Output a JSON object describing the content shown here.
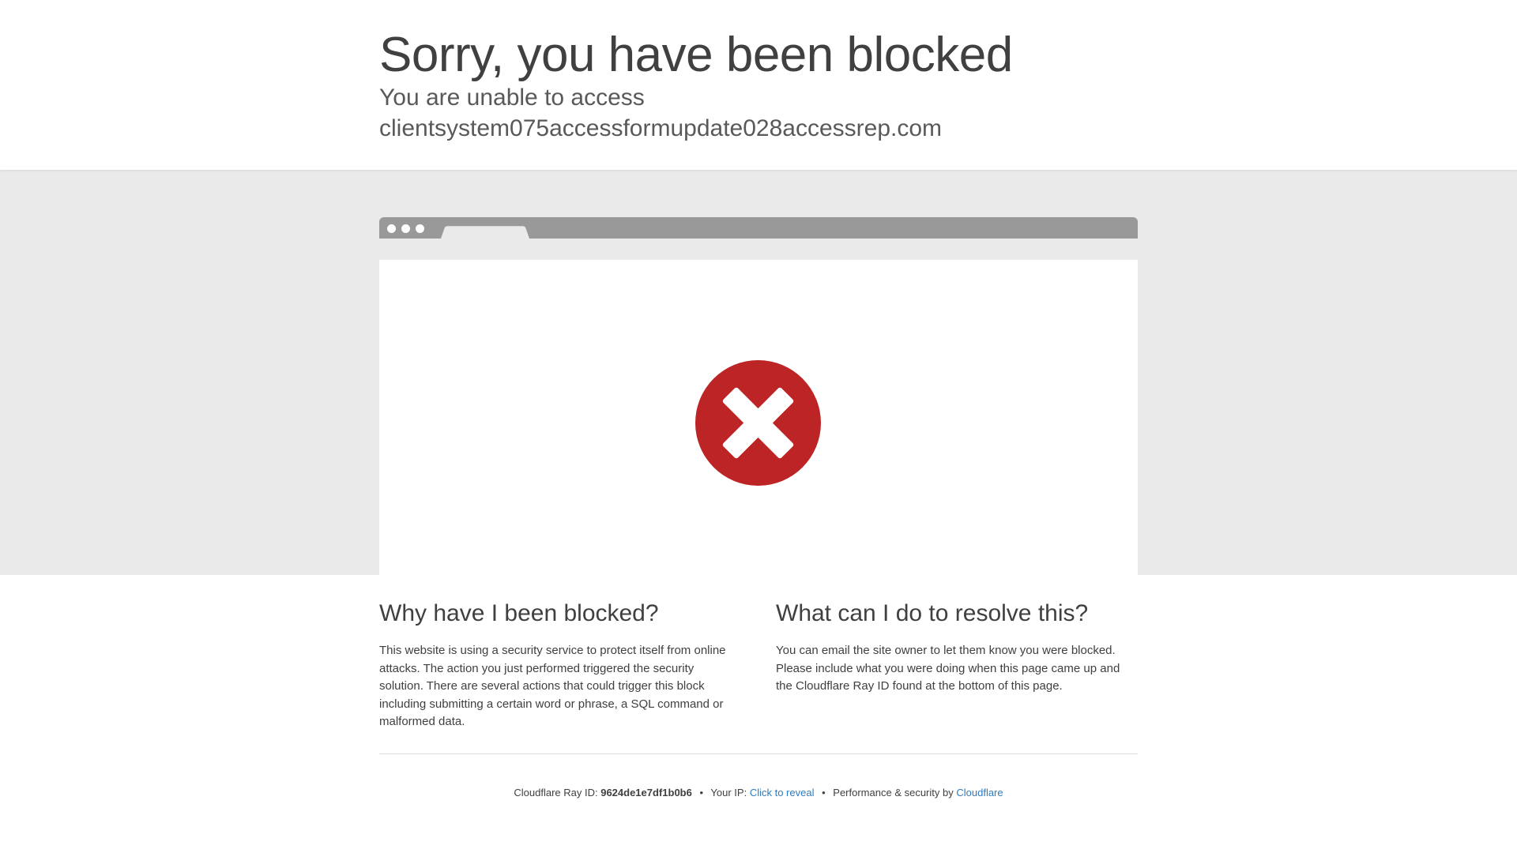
{
  "header": {
    "title": "Sorry, you have been blocked",
    "subtitle_prefix": "You are unable to access",
    "domain": "clientsystem075accessformupdate028accessrep.com"
  },
  "illustration": {
    "icon": "blocked-x-icon",
    "icon_color": "#bd2426"
  },
  "why": {
    "heading": "Why have I been blocked?",
    "body": "This website is using a security service to protect itself from online attacks. The action you just performed triggered the security solution. There are several actions that could trigger this block including submitting a certain word or phrase, a SQL command or malformed data."
  },
  "resolve": {
    "heading": "What can I do to resolve this?",
    "body": "You can email the site owner to let them know you were blocked. Please include what you were doing when this page came up and the Cloudflare Ray ID found at the bottom of this page."
  },
  "footer": {
    "ray_label": "Cloudflare Ray ID:",
    "ray_id": "9624de1e7df1b0b6",
    "separator": "•",
    "ip_label": "Your IP:",
    "ip_link": "Click to reveal",
    "perf_label": "Performance & security by",
    "brand_link": "Cloudflare",
    "link_color": "#2f7bbf"
  }
}
